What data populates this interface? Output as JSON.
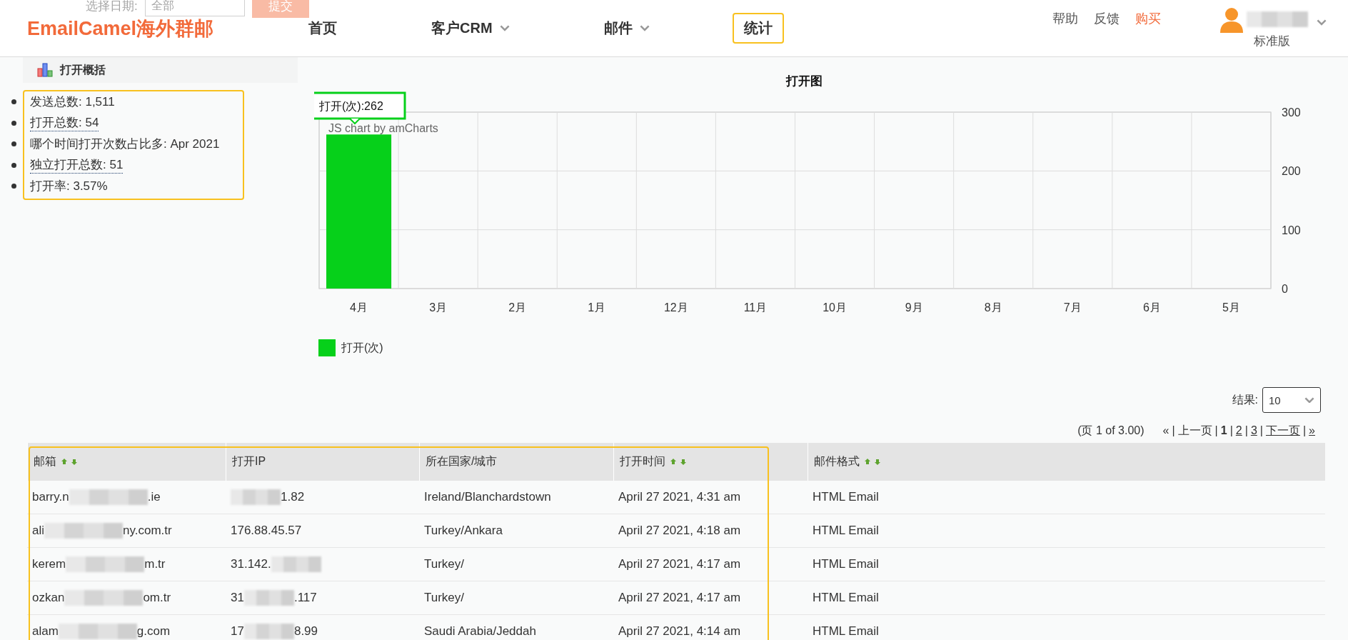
{
  "background_filter": {
    "label": "选择日期:",
    "select_value": "全部",
    "button": "提交"
  },
  "header": {
    "logo": "EmailCamel海外群邮",
    "nav": [
      {
        "label": "首页",
        "dropdown": false,
        "selected": false
      },
      {
        "label": "客户CRM",
        "dropdown": true,
        "selected": false
      },
      {
        "label": "邮件",
        "dropdown": true,
        "selected": false
      },
      {
        "label": "统计",
        "dropdown": false,
        "selected": true
      }
    ],
    "links": [
      {
        "label": "帮助",
        "highlight": false
      },
      {
        "label": "反馈",
        "highlight": false
      },
      {
        "label": "购买",
        "highlight": true
      }
    ],
    "user": {
      "plan": "标准版"
    }
  },
  "summary": {
    "title": "打开概括",
    "items": [
      {
        "text": "发送总数: 1,511",
        "link": false
      },
      {
        "text": "打开总数: 54",
        "link": true
      },
      {
        "text": "哪个时间打开次数占比多: Apr 2021",
        "link": false
      },
      {
        "text": "独立打开总数: 51",
        "link": true
      },
      {
        "text": "打开率: 3.57%",
        "link": false
      }
    ]
  },
  "chart": {
    "tooltip": "打开(次):262",
    "credit": "JS chart by amCharts",
    "chart_data": {
      "type": "bar",
      "title": "打开图",
      "categories": [
        "4月",
        "3月",
        "2月",
        "1月",
        "12月",
        "11月",
        "10月",
        "9月",
        "8月",
        "7月",
        "6月",
        "5月"
      ],
      "series": [
        {
          "name": "打开(次)",
          "color": "#06d01a",
          "values": [
            262,
            0,
            0,
            0,
            0,
            0,
            0,
            0,
            0,
            0,
            0,
            0
          ]
        }
      ],
      "ylim": [
        0,
        300
      ],
      "yticks": [
        0,
        100,
        200,
        300
      ]
    }
  },
  "results": {
    "label": "结果:",
    "value": "10"
  },
  "pagination": {
    "info": "(页 1 of 3.00)",
    "items": [
      {
        "label": "«",
        "kind": "text"
      },
      {
        "label": "|",
        "kind": "text"
      },
      {
        "label": "上一页",
        "kind": "text"
      },
      {
        "label": "|",
        "kind": "text"
      },
      {
        "label": "1",
        "kind": "current"
      },
      {
        "label": "|",
        "kind": "text"
      },
      {
        "label": "2",
        "kind": "link"
      },
      {
        "label": "|",
        "kind": "text"
      },
      {
        "label": "3",
        "kind": "link"
      },
      {
        "label": "|",
        "kind": "text"
      },
      {
        "label": "下一页",
        "kind": "link"
      },
      {
        "label": "|",
        "kind": "text"
      },
      {
        "label": "»",
        "kind": "link"
      }
    ]
  },
  "table": {
    "columns": [
      {
        "label": "邮箱",
        "sortable": true
      },
      {
        "label": "打开IP",
        "sortable": false
      },
      {
        "label": "所在国家/城市",
        "sortable": false
      },
      {
        "label": "打开时间",
        "sortable": true
      },
      {
        "label": "邮件格式",
        "sortable": true
      }
    ],
    "rows": [
      {
        "cells": [
          [
            {
              "kind": "text",
              "text": "barry.n"
            },
            {
              "kind": "mosaic"
            },
            {
              "kind": "text",
              "text": ".ie"
            }
          ],
          [
            {
              "kind": "mosaic"
            },
            {
              "kind": "text",
              "text": "1.82"
            }
          ],
          [
            {
              "kind": "text",
              "text": "Ireland/Blanchardstown"
            }
          ],
          [
            {
              "kind": "text",
              "text": "April 27 2021, 4:31 am"
            }
          ],
          [
            {
              "kind": "text",
              "text": "HTML Email"
            }
          ]
        ]
      },
      {
        "cells": [
          [
            {
              "kind": "text",
              "text": "ali"
            },
            {
              "kind": "mosaic"
            },
            {
              "kind": "text",
              "text": "ny.com.tr"
            }
          ],
          [
            {
              "kind": "text",
              "text": "176.88.45.57"
            }
          ],
          [
            {
              "kind": "text",
              "text": "Turkey/Ankara"
            }
          ],
          [
            {
              "kind": "text",
              "text": "April 27 2021, 4:18 am"
            }
          ],
          [
            {
              "kind": "text",
              "text": "HTML Email"
            }
          ]
        ]
      },
      {
        "cells": [
          [
            {
              "kind": "text",
              "text": "kerem"
            },
            {
              "kind": "mosaic"
            },
            {
              "kind": "text",
              "text": "m.tr"
            }
          ],
          [
            {
              "kind": "text",
              "text": "31.142."
            },
            {
              "kind": "mosaic"
            }
          ],
          [
            {
              "kind": "text",
              "text": "Turkey/"
            }
          ],
          [
            {
              "kind": "text",
              "text": "April 27 2021, 4:17 am"
            }
          ],
          [
            {
              "kind": "text",
              "text": "HTML Email"
            }
          ]
        ]
      },
      {
        "cells": [
          [
            {
              "kind": "text",
              "text": "ozkan"
            },
            {
              "kind": "mosaic"
            },
            {
              "kind": "text",
              "text": "om.tr"
            }
          ],
          [
            {
              "kind": "text",
              "text": "31"
            },
            {
              "kind": "mosaic"
            },
            {
              "kind": "text",
              "text": ".117"
            }
          ],
          [
            {
              "kind": "text",
              "text": "Turkey/"
            }
          ],
          [
            {
              "kind": "text",
              "text": "April 27 2021, 4:17 am"
            }
          ],
          [
            {
              "kind": "text",
              "text": "HTML Email"
            }
          ]
        ]
      },
      {
        "cells": [
          [
            {
              "kind": "text",
              "text": "alam"
            },
            {
              "kind": "mosaic"
            },
            {
              "kind": "text",
              "text": "g.com"
            }
          ],
          [
            {
              "kind": "text",
              "text": "17"
            },
            {
              "kind": "mosaic"
            },
            {
              "kind": "text",
              "text": "8.99"
            }
          ],
          [
            {
              "kind": "text",
              "text": "Saudi Arabia/Jeddah"
            }
          ],
          [
            {
              "kind": "text",
              "text": "April 27 2021, 4:14 am"
            }
          ],
          [
            {
              "kind": "text",
              "text": "HTML Email"
            }
          ]
        ]
      }
    ]
  }
}
